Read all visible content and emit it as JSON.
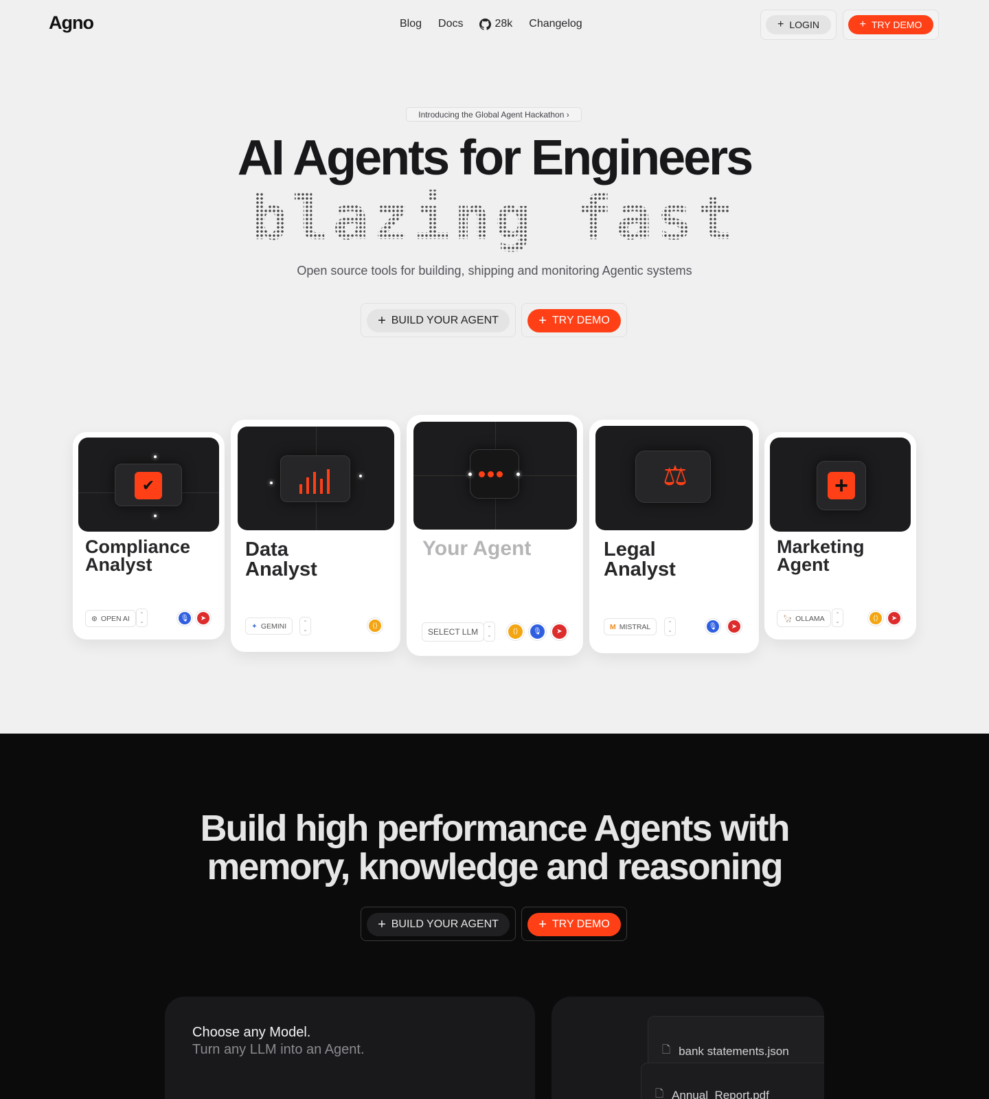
{
  "header": {
    "logo": "Agno",
    "nav": {
      "blog": "Blog",
      "docs": "Docs",
      "github_stars": "28k",
      "changelog": "Changelog"
    },
    "login_label": "LOGIN",
    "try_demo_label": "TRY DEMO"
  },
  "hero": {
    "announcement": "Introducing the Global Agent Hackathon ›",
    "title": "AI Agents for Engineers",
    "tagline": "blazing fast",
    "subtitle": "Open source tools for building, shipping and monitoring Agentic systems",
    "build_label": "BUILD YOUR AGENT",
    "try_demo_label": "TRY DEMO"
  },
  "cards": [
    {
      "title_line1": "Compliance",
      "title_line2": "Analyst",
      "model": "OPEN AI",
      "icon": "checkmark-icon",
      "tools": [
        "microphone-icon",
        "send-icon"
      ]
    },
    {
      "title_line1": "Data",
      "title_line2": "Analyst",
      "model": "GEMINI",
      "icon": "bar-chart-icon",
      "tools": [
        "code-icon"
      ]
    },
    {
      "title_line1": "Your Agent",
      "title_line2": "",
      "model": "SELECT LLM",
      "icon": "ellipsis-icon",
      "tools": [
        "code-icon",
        "microphone-icon",
        "send-icon"
      ]
    },
    {
      "title_line1": "Legal",
      "title_line2": "Analyst",
      "model": "MISTRAL",
      "icon": "scales-icon",
      "tools": [
        "microphone-icon",
        "send-icon"
      ]
    },
    {
      "title_line1": "Marketing",
      "title_line2": "Agent",
      "model": "OLLAMA",
      "icon": "plus-icon",
      "tools": [
        "code-icon",
        "send-icon"
      ]
    }
  ],
  "dark_section": {
    "title_line1": "Build high performance Agents with",
    "title_line2": "memory, knowledge and reasoning",
    "build_label": "BUILD YOUR AGENT",
    "try_demo_label": "TRY DEMO",
    "model_panel": {
      "heading": "Choose any Model.",
      "subheading": "Turn any LLM into an Agent."
    },
    "files": [
      "bank statements.json",
      "Annual_Report.pdf"
    ]
  },
  "colors": {
    "accent": "#ff4017",
    "dark_bg": "#0b0b0c",
    "light_bg": "#f0f0f0"
  }
}
